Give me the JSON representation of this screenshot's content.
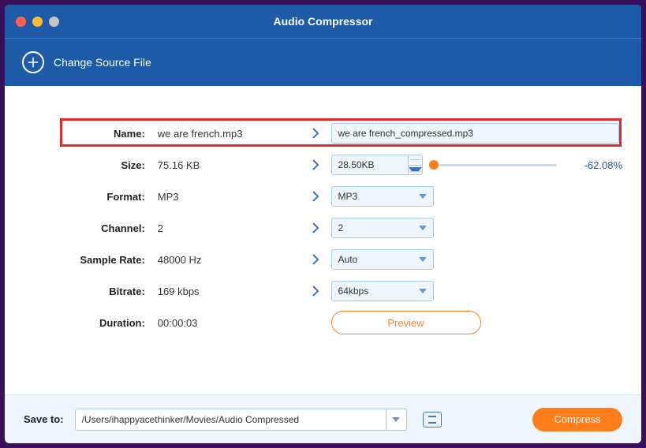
{
  "window": {
    "title": "Audio Compressor"
  },
  "toolbar": {
    "change_source": "Change Source File"
  },
  "rows": {
    "name": {
      "label": "Name:",
      "orig": "we are french.mp3",
      "target": "we are french_compressed.mp3"
    },
    "size": {
      "label": "Size:",
      "orig": "75.16 KB",
      "target": "28.50KB",
      "pct": "-62.08%"
    },
    "format": {
      "label": "Format:",
      "orig": "MP3",
      "target": "MP3"
    },
    "channel": {
      "label": "Channel:",
      "orig": "2",
      "target": "2"
    },
    "sample_rate": {
      "label": "Sample Rate:",
      "orig": "48000 Hz",
      "target": "Auto"
    },
    "bitrate": {
      "label": "Bitrate:",
      "orig": "169 kbps",
      "target": "64kbps"
    },
    "duration": {
      "label": "Duration:",
      "orig": "00:00:03"
    }
  },
  "buttons": {
    "preview": "Preview",
    "compress": "Compress"
  },
  "footer": {
    "save_label": "Save to:",
    "path": "/Users/ihappyacethinker/Movies/Audio Compressed"
  },
  "slider": {
    "position_pct": 3
  }
}
